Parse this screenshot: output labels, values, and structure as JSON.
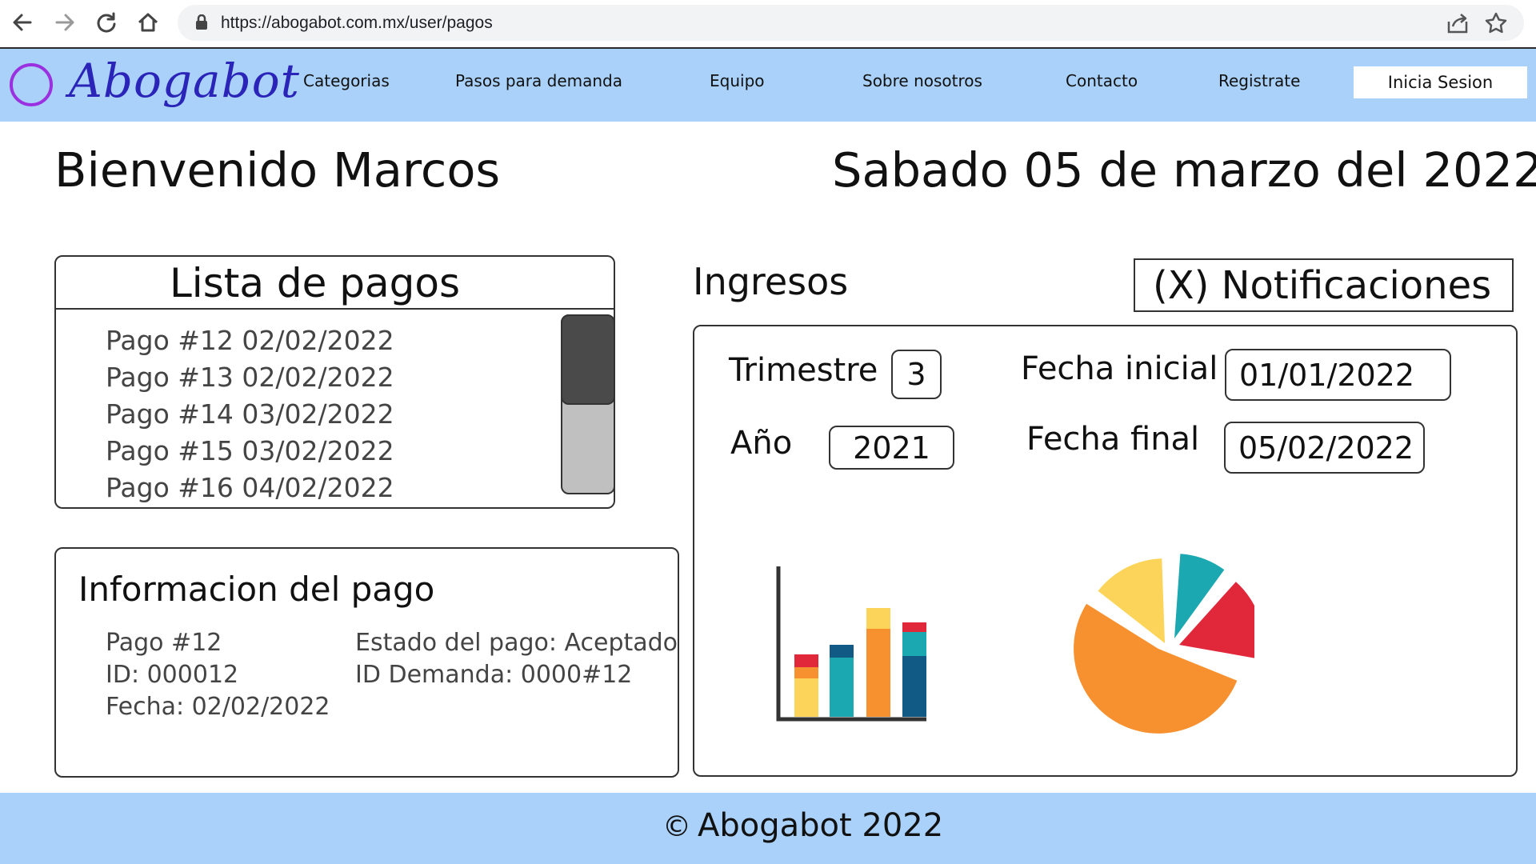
{
  "browser": {
    "url": "https://abogabot.com.mx/user/pagos",
    "icons": [
      "back-icon",
      "forward-icon",
      "reload-icon",
      "home-icon",
      "lock-icon",
      "share-icon",
      "star-icon"
    ]
  },
  "header": {
    "logo": "Abogabot",
    "nav": [
      "Categorias",
      "Pasos para demanda",
      "Equipo",
      "Sobre nosotros",
      "Contacto",
      "Registrate"
    ],
    "login": "Inicia Sesion"
  },
  "welcome": "Bienvenido Marcos",
  "date": "Sabado 05 de marzo del 2022",
  "payments": {
    "title": "Lista de pagos",
    "items": [
      "Pago #12 02/02/2022",
      "Pago #13 02/02/2022",
      "Pago #14 03/02/2022",
      "Pago #15 03/02/2022",
      "Pago #16 04/02/2022"
    ]
  },
  "payment_info": {
    "title": "Informacion del pago",
    "left": [
      "Pago #12",
      "ID: 000012",
      "Fecha: 02/02/2022"
    ],
    "right": [
      "Estado del pago: Aceptado",
      "ID Demanda: 0000#12"
    ]
  },
  "income": {
    "title": "Ingresos",
    "notifications": "(X) Notificaciones",
    "trimestre_label": "Trimestre",
    "trimestre_value": "3",
    "anio_label": "Año",
    "anio_value": "2021",
    "fecha_inicial_label": "Fecha inicial",
    "fecha_inicial_value": "01/01/2022",
    "fecha_final_label": "Fecha final",
    "fecha_final_value": "05/02/2022"
  },
  "footer": {
    "copyright_symbol": "©",
    "text": "Abogabot 2022"
  },
  "colors": {
    "header_bg": "#a9d1f9",
    "logo_text": "#2a24b8",
    "logo_ring": "#9b30e0",
    "chart_yellow": "#fcd45a",
    "chart_orange": "#f7912f",
    "chart_red": "#e0283a",
    "chart_teal": "#1ba8b0",
    "chart_navy": "#115a86"
  }
}
